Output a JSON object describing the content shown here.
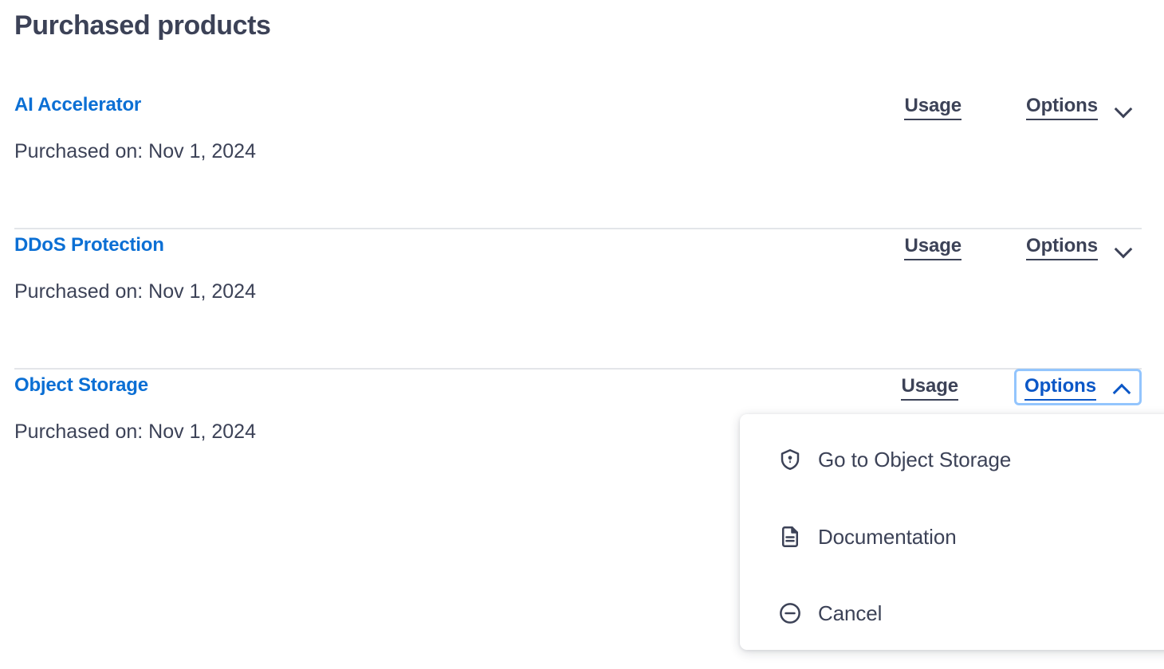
{
  "page": {
    "title": "Purchased products"
  },
  "colors": {
    "link_blue": "#0b6fd4",
    "text_slate": "#3c4257",
    "focus_ring": "#93c5fd",
    "focus_text": "#0b57c7",
    "divider": "#e3e5e9",
    "background": "#ffffff"
  },
  "products": [
    {
      "name": "AI Accelerator",
      "purchased": "Purchased on: Nov 1, 2024",
      "usage_label": "Usage",
      "options_label": "Options",
      "chevron_icon": "chevron-down-icon",
      "expanded": false
    },
    {
      "name": "DDoS Protection",
      "purchased": "Purchased on: Nov 1, 2024",
      "usage_label": "Usage",
      "options_label": "Options",
      "chevron_icon": "chevron-down-icon",
      "expanded": false
    },
    {
      "name": "Object Storage",
      "purchased": "Purchased on: Nov 1, 2024",
      "usage_label": "Usage",
      "options_label": "Options",
      "chevron_icon": "chevron-up-icon",
      "expanded": true
    }
  ],
  "dropdown": {
    "owner": "Object Storage",
    "items": [
      {
        "label": "Go to Object Storage",
        "icon": "shield-keyhole-icon"
      },
      {
        "label": "Documentation",
        "icon": "document-icon"
      },
      {
        "label": "Cancel",
        "icon": "minus-circle-icon"
      }
    ]
  }
}
